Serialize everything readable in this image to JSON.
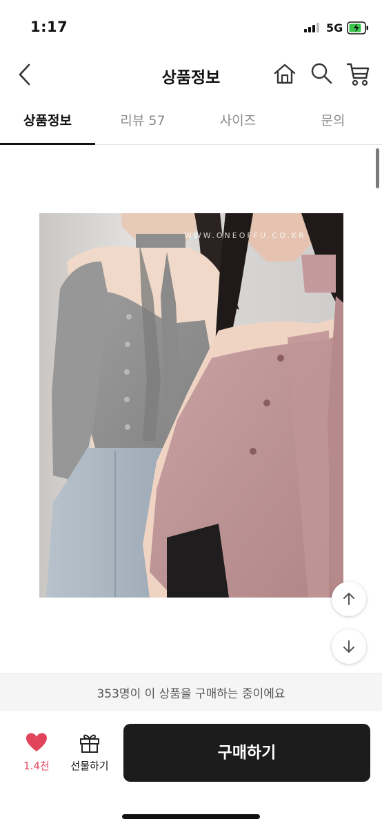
{
  "status_bar": {
    "time": "1:17",
    "network": "5G"
  },
  "nav": {
    "title": "상품정보"
  },
  "tabs": [
    {
      "label": "상품정보",
      "active": true
    },
    {
      "label": "리뷰 57",
      "active": false
    },
    {
      "label": "사이즈",
      "active": false
    },
    {
      "label": "문의",
      "active": false
    }
  ],
  "product_image": {
    "watermark": "WWW.ONEOFFU.CO.KR"
  },
  "banner": {
    "text": "353명이 이 상품을 구매하는 중이에요"
  },
  "bottom_bar": {
    "like_count": "1.4천",
    "gift_label": "선물하기",
    "buy_label": "구매하기"
  },
  "colors": {
    "accent": "#e2455b",
    "buy_button": "#1c1c1c"
  },
  "icons": [
    "back-icon",
    "home-icon",
    "search-icon",
    "cart-icon",
    "heart-icon",
    "gift-icon",
    "arrow-up-icon",
    "arrow-down-icon"
  ]
}
